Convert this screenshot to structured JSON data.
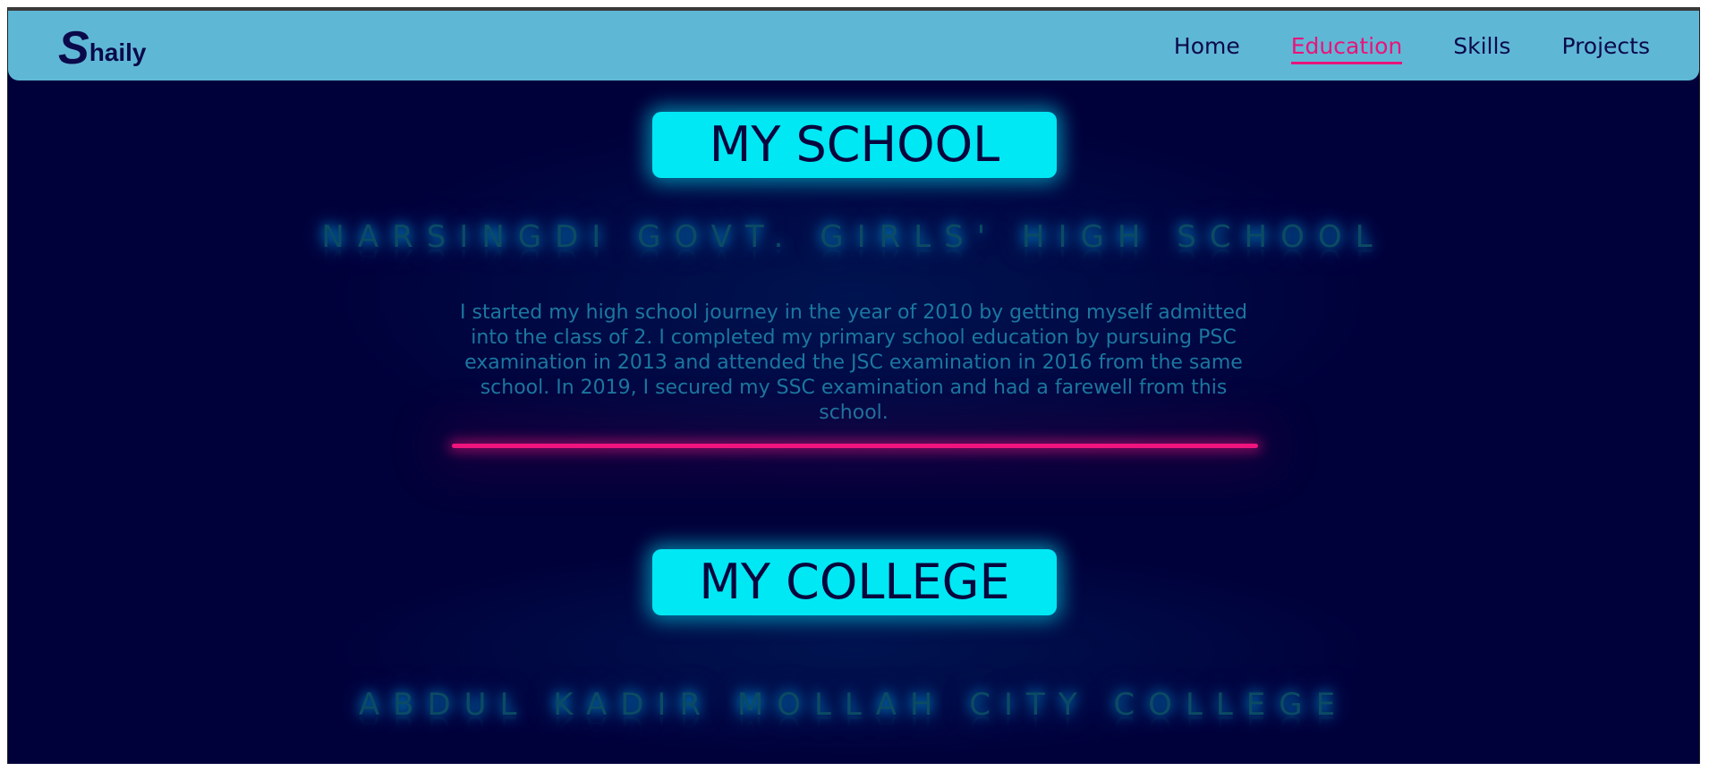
{
  "navbar": {
    "logo_big": "S",
    "logo_rest": "haily",
    "links": [
      {
        "label": "Home"
      },
      {
        "label": "Education"
      },
      {
        "label": "Skills"
      },
      {
        "label": "Projects"
      }
    ],
    "active_link": "Education"
  },
  "school": {
    "heading": "MY SCHOOL",
    "name": "NARSINGDI GOVT. GIRLS' HIGH SCHOOL",
    "description": "I started my high school journey in the year of 2010 by getting myself admitted into the class of 2. I completed my primary school education by pursuing PSC examination in 2013 and attended the JSC examination in 2016 from the same school. In 2019, I secured my SSC examination and had a farewell from this school."
  },
  "college": {
    "heading": "MY COLLEGE",
    "name": "ABDUL KADIR MOLLAH CITY COLLEGE"
  },
  "colors": {
    "background": "#00003a",
    "navbar": "#5fb7d6",
    "accent_cyan": "#00e8f4",
    "accent_pink": "#e8147a",
    "institution_text": "#0b4b63",
    "paragraph_text": "#1b77a0"
  }
}
